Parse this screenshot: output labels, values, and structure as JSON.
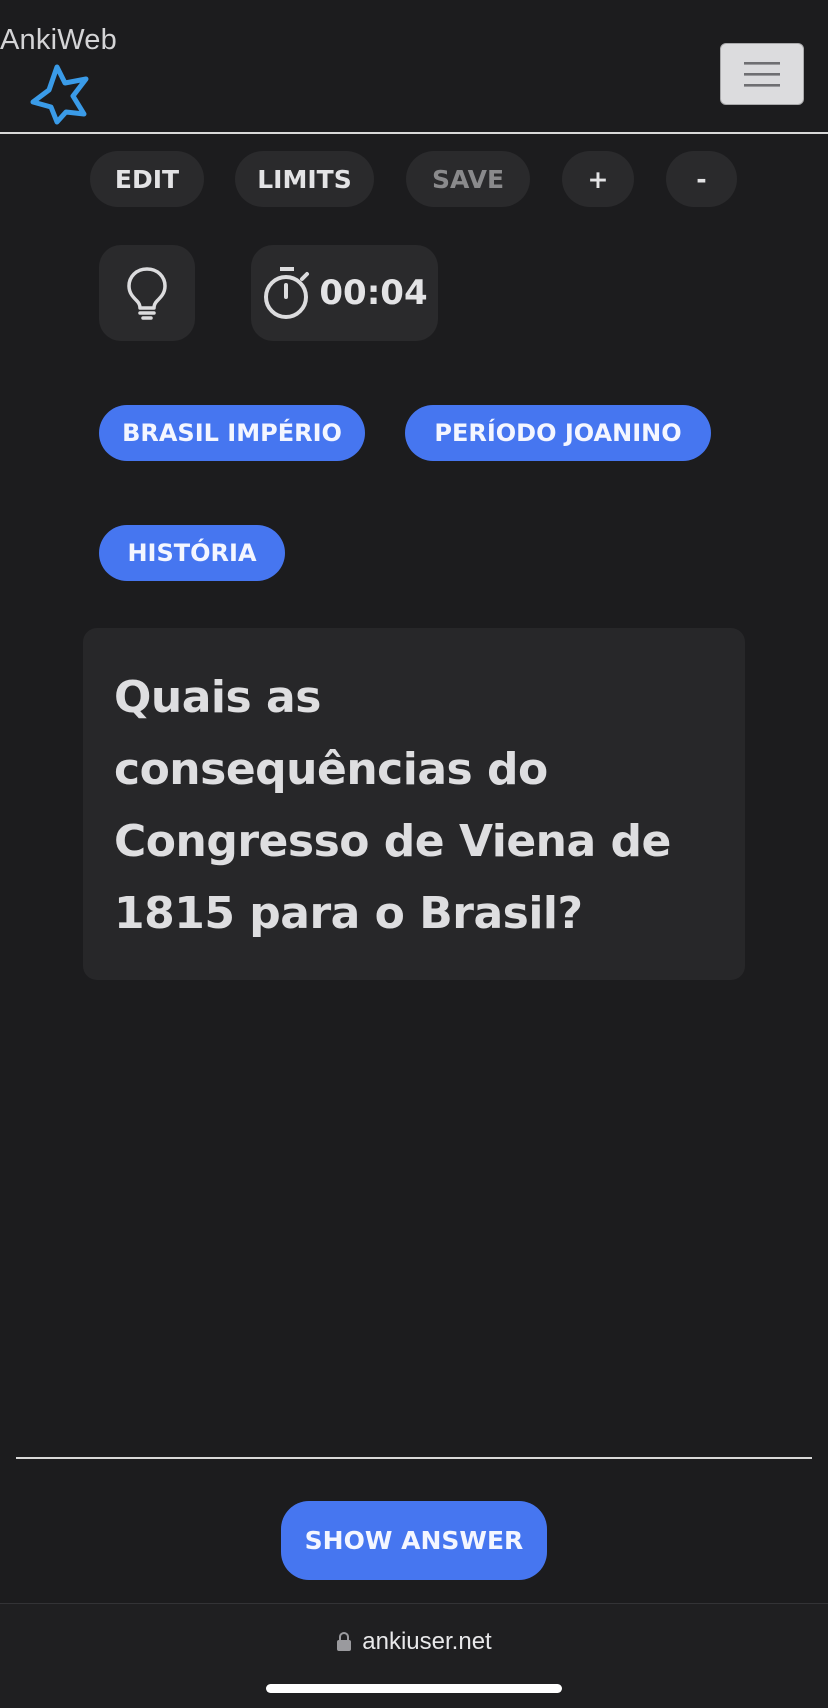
{
  "brand": {
    "name": "AnkiWeb",
    "logo_icon": "star-outline-icon",
    "accent": "#3a9be8"
  },
  "navbar": {
    "menu_icon": "hamburger-icon"
  },
  "toolbar": {
    "edit_label": "EDIT",
    "limits_label": "LIMITS",
    "save_label": "SAVE",
    "plus_label": "+",
    "minus_label": "-"
  },
  "controls": {
    "hint_icon": "lightbulb-icon",
    "timer_icon": "stopwatch-icon",
    "timer_value": "00:04"
  },
  "tags": [
    {
      "label": "BRASIL IMPÉRIO"
    },
    {
      "label": "PERÍODO JOANINO"
    },
    {
      "label": "HISTÓRIA"
    }
  ],
  "card": {
    "question_lines": [
      "Quais as",
      "consequências do",
      "Congresso de Viena de",
      "1815 para o Brasil?"
    ]
  },
  "footer": {
    "show_answer_label": "SHOW ANSWER"
  },
  "browser": {
    "url": "ankiuser.net",
    "lock_icon": "lock-icon"
  },
  "colors": {
    "background": "#1c1c1e",
    "button_bg": "#2a2a2c",
    "primary": "#4676f0",
    "card_bg": "#272729"
  }
}
